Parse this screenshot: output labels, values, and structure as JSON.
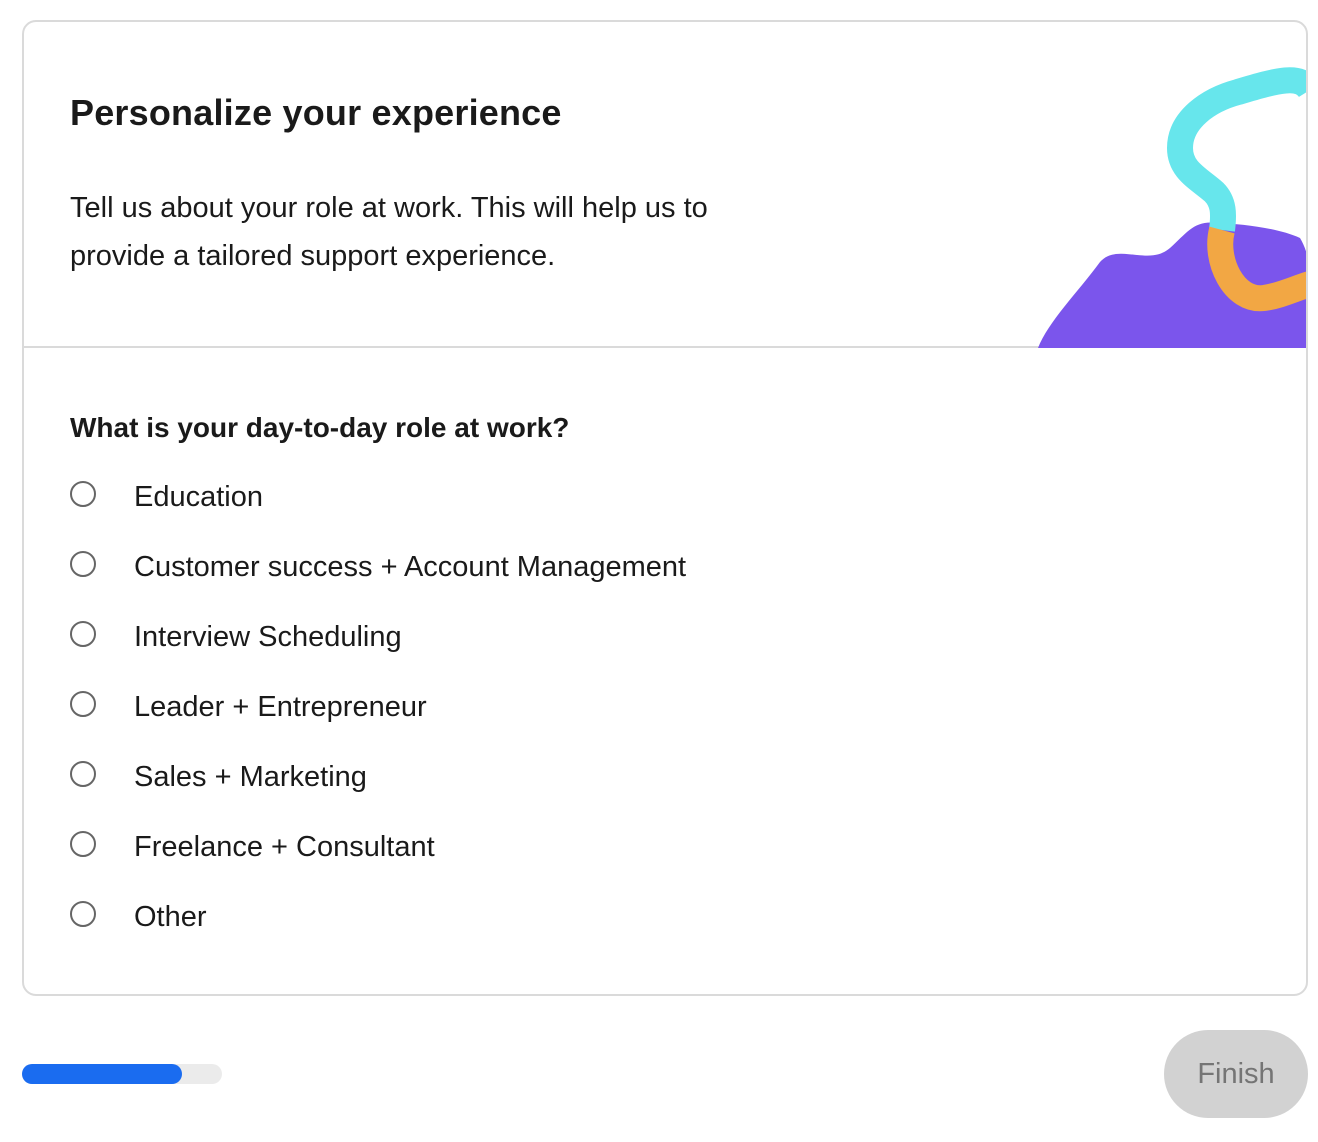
{
  "header": {
    "title": "Personalize your experience",
    "description": "Tell us about your role at work. This will help us to provide a tailored support experience.",
    "illustration": "abstract-shapes-illustration"
  },
  "question": {
    "label": "What is your day-to-day role at work?",
    "options": [
      {
        "label": "Education",
        "selected": false
      },
      {
        "label": "Customer success + Account Management",
        "selected": false
      },
      {
        "label": "Interview Scheduling",
        "selected": false
      },
      {
        "label": "Leader + Entrepreneur",
        "selected": false
      },
      {
        "label": "Sales + Marketing",
        "selected": false
      },
      {
        "label": "Freelance + Consultant",
        "selected": false
      },
      {
        "label": "Other",
        "selected": false
      }
    ]
  },
  "footer": {
    "progress_fraction": 0.8,
    "finish_label": "Finish",
    "finish_disabled": true
  },
  "colors": {
    "accent": "#1a6cf0",
    "illustration_purple": "#7b55ec",
    "illustration_cyan": "#67e6ec",
    "illustration_orange": "#f2a744",
    "button_disabled_bg": "#d2d2d2"
  }
}
